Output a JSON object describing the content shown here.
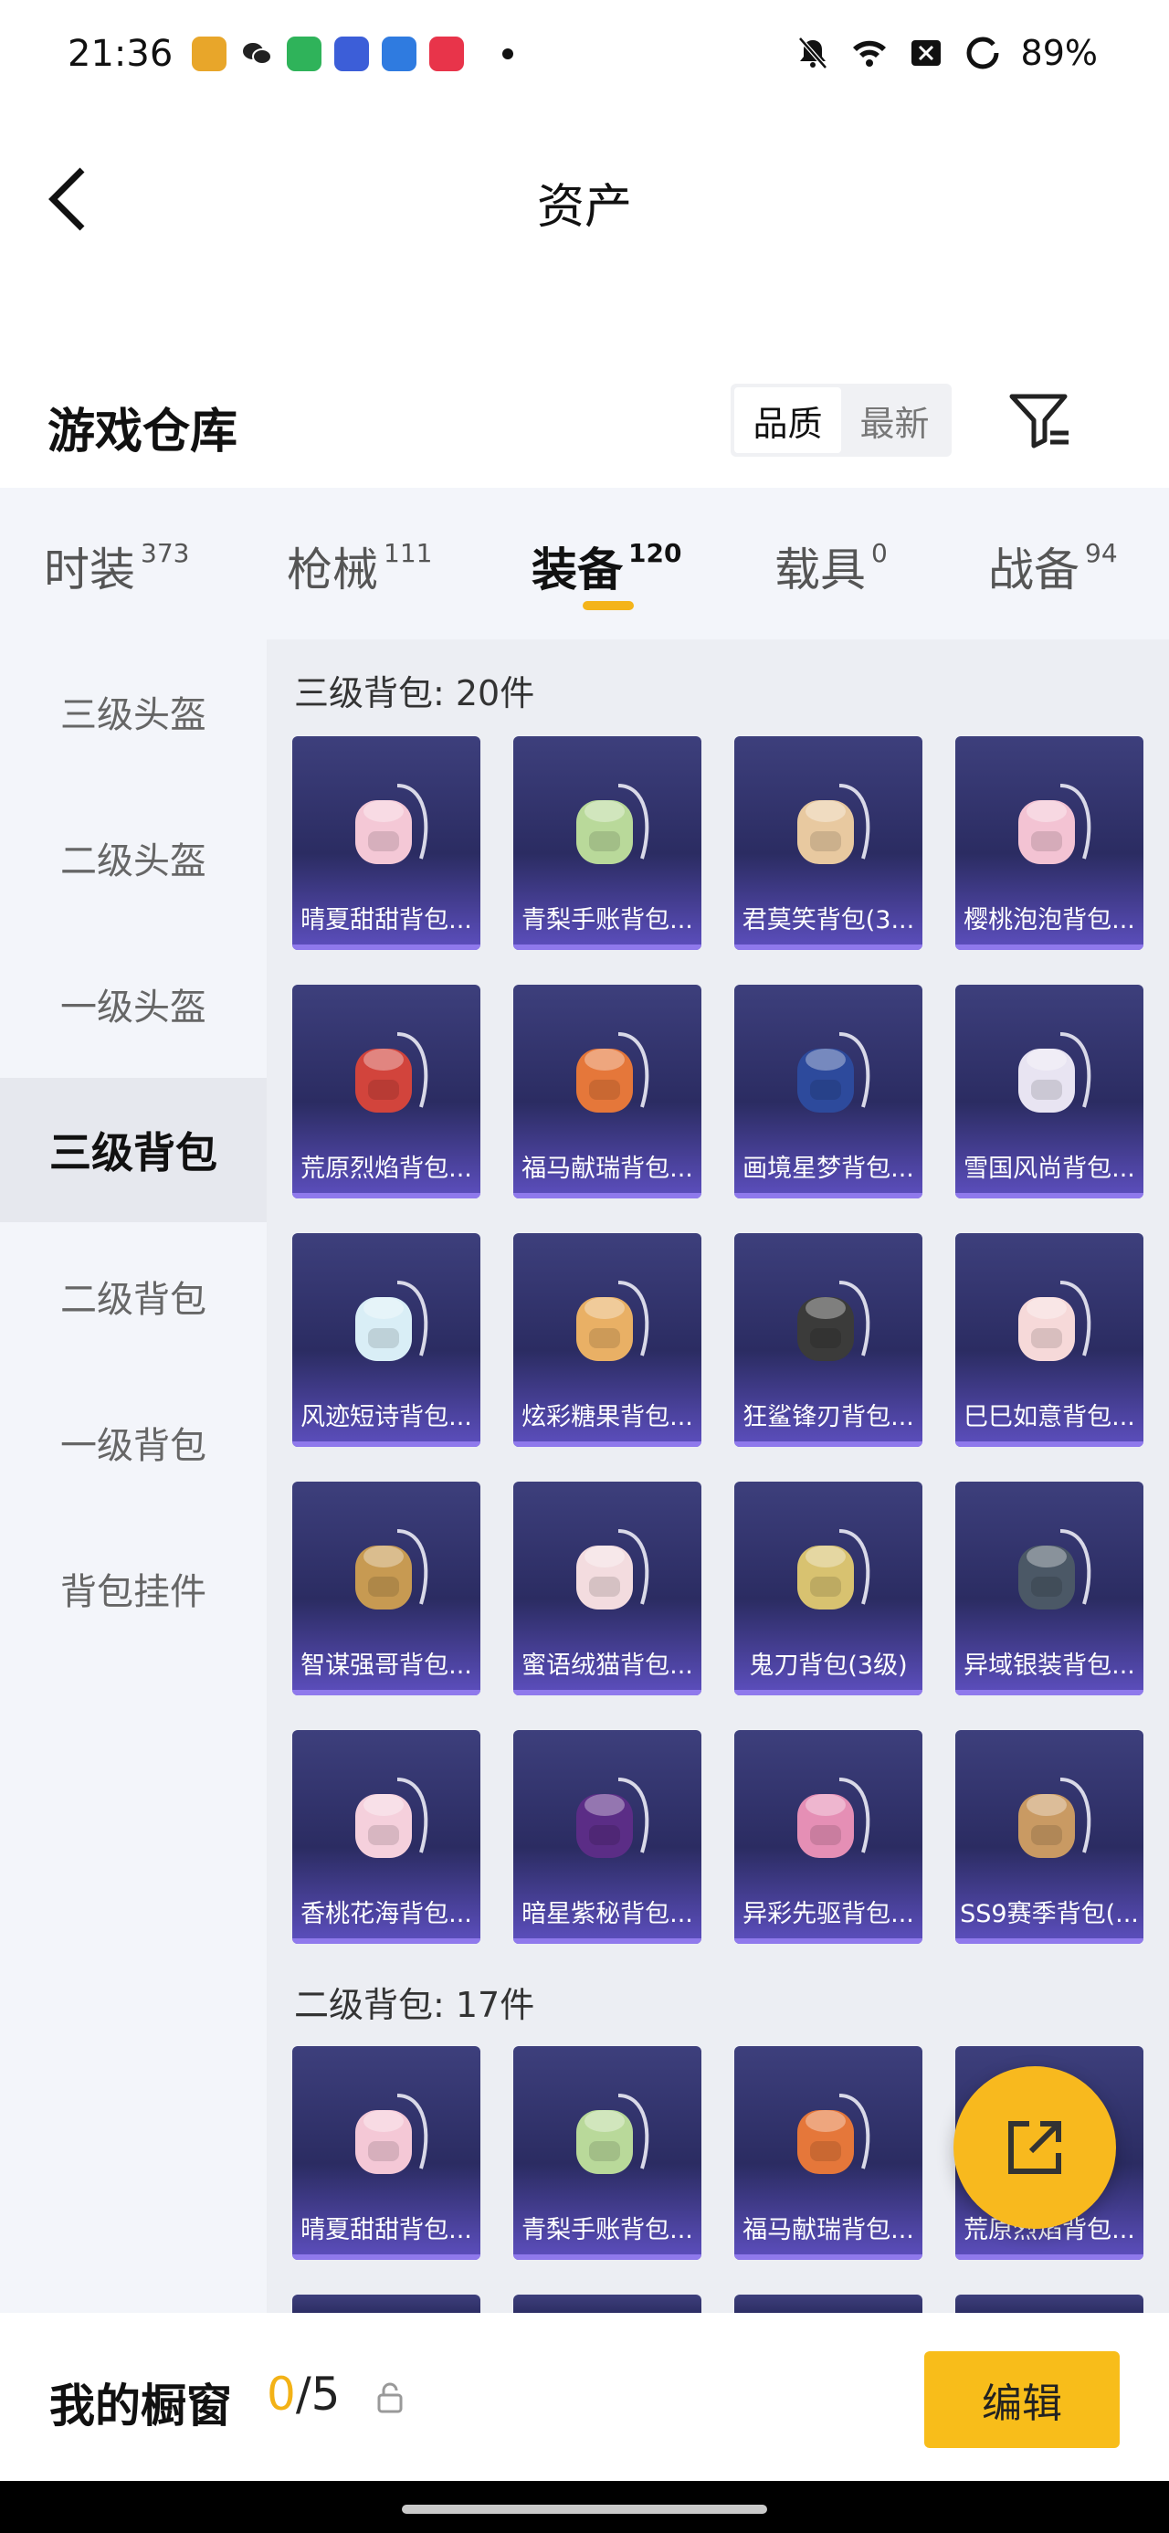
{
  "status_bar": {
    "time": "21:36",
    "battery": "89%",
    "app_icons": [
      "game-app-icon",
      "wechat-icon",
      "security-app-icon",
      "game-icon",
      "game-icon-2",
      "music-icon"
    ]
  },
  "header": {
    "title": "资产",
    "back_icon": "back-arrow-icon"
  },
  "warehouse": {
    "title": "游戏仓库",
    "sort_options": [
      "品质",
      "最新"
    ],
    "filter_icon": "filter-icon"
  },
  "tabs": [
    {
      "label": "时装",
      "count": "373"
    },
    {
      "label": "枪械",
      "count": "111"
    },
    {
      "label": "装备",
      "count": "120",
      "active": true
    },
    {
      "label": "载具",
      "count": "0"
    },
    {
      "label": "战备",
      "count": "94"
    }
  ],
  "sidebar": [
    {
      "label": "三级头盔"
    },
    {
      "label": "二级头盔"
    },
    {
      "label": "一级头盔"
    },
    {
      "label": "三级背包",
      "active": true
    },
    {
      "label": "二级背包"
    },
    {
      "label": "一级背包"
    },
    {
      "label": "背包挂件"
    }
  ],
  "sections": [
    {
      "title": "三级背包: 20件",
      "items": [
        "晴夏甜甜背包...",
        "青梨手账背包...",
        "君莫笑背包(3...",
        "樱桃泡泡背包...",
        "荒原烈焰背包...",
        "福马献瑞背包...",
        "画境星梦背包...",
        "雪国风尚背包...",
        "风迹短诗背包...",
        "炫彩糖果背包...",
        "狂鲨锋刃背包...",
        "巳巳如意背包...",
        "智谋强哥背包...",
        "蜜语绒猫背包...",
        "鬼刀背包(3级)",
        "异域银装背包...",
        "香桃花海背包...",
        "暗星紫秘背包...",
        "异彩先驱背包...",
        "SS9赛季背包(..."
      ]
    },
    {
      "title": "二级背包: 17件",
      "items": [
        "晴夏甜甜背包...",
        "青梨手账背包...",
        "福马献瑞背包...",
        "荒原烈焰背包..."
      ]
    }
  ],
  "bottom_bar": {
    "title": "我的橱窗",
    "count_current": "0",
    "count_total": "/5",
    "edit_label": "编辑"
  },
  "colors": {
    "accent": "#f8b91e",
    "card_bg": "#2b2c62",
    "card_bottom": "#8f79ec"
  }
}
